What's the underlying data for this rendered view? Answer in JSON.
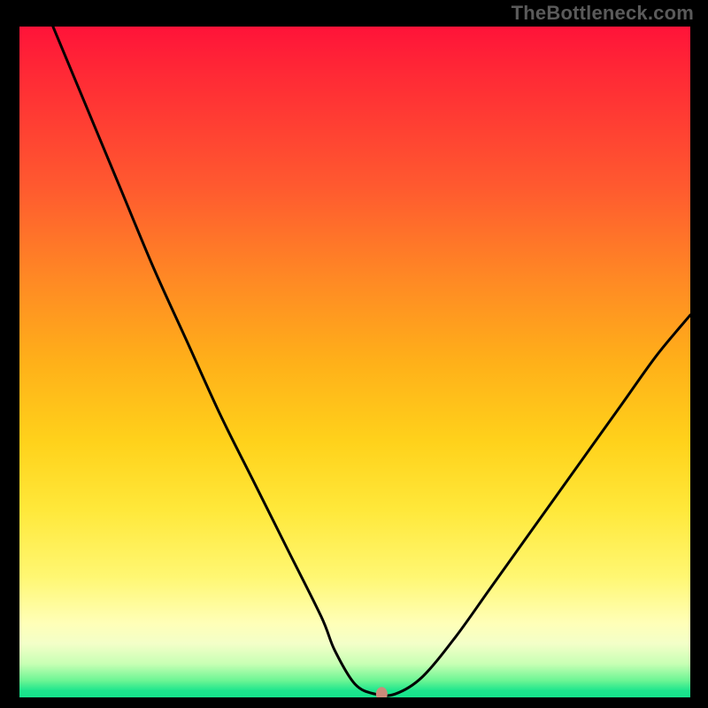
{
  "watermark": "TheBottleneck.com",
  "chart_data": {
    "type": "line",
    "title": "",
    "xlabel": "",
    "ylabel": "",
    "xlim": [
      0,
      100
    ],
    "ylim": [
      0,
      100
    ],
    "grid": false,
    "legend": false,
    "description": "V-shaped bottleneck curve over vertical red-to-green gradient. Y encodes bottleneck severity (top=red=high, bottom=green=none). Minimum (optimal point) marked with a dot near the curve's lowest point.",
    "series": [
      {
        "name": "bottleneck-curve",
        "color": "#000000",
        "x": [
          5,
          10,
          15,
          20,
          25,
          30,
          35,
          40,
          45,
          47,
          50,
          53,
          56,
          60,
          65,
          70,
          75,
          80,
          85,
          90,
          95,
          100
        ],
        "y": [
          100,
          88,
          76,
          64,
          53,
          42,
          32,
          22,
          12,
          7,
          2,
          0.5,
          0.5,
          3,
          9,
          16,
          23,
          30,
          37,
          44,
          51,
          57
        ]
      }
    ],
    "marker": {
      "name": "optimal-point",
      "x": 54,
      "y": 0.5,
      "color": "#cb8b7a"
    },
    "gradient_stops": [
      {
        "pct": 0,
        "color": "#ff1339"
      },
      {
        "pct": 50,
        "color": "#ffb019"
      },
      {
        "pct": 82,
        "color": "#fff772"
      },
      {
        "pct": 100,
        "color": "#15e38c"
      }
    ]
  }
}
